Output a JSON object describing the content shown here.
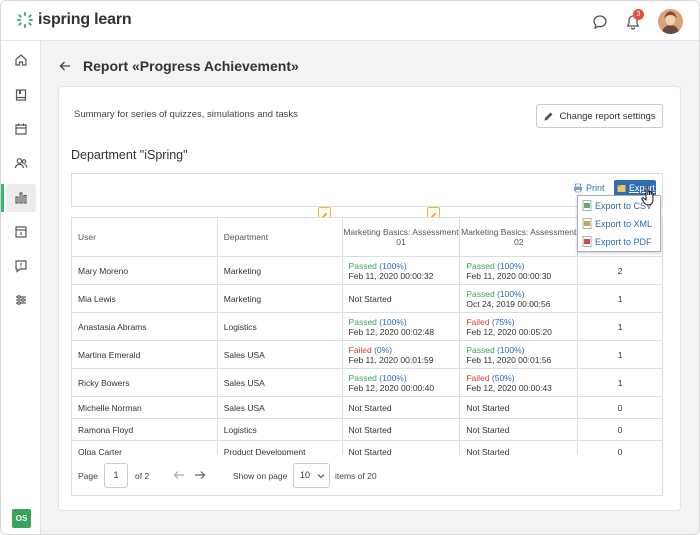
{
  "app": {
    "logo_text": "ispring learn",
    "notification_count": "3",
    "user_initials": "OS"
  },
  "colors": {
    "accent": "#3cb371",
    "link": "#2a6bb5",
    "passed": "#3fa34d",
    "failed": "#d0462e",
    "export_button": "#2f6db5"
  },
  "sidebar": {
    "items": [
      {
        "icon": "home-icon"
      },
      {
        "icon": "book-icon"
      },
      {
        "icon": "calendar-icon"
      },
      {
        "icon": "users-icon"
      },
      {
        "icon": "reports-icon",
        "active": true
      },
      {
        "icon": "tasks-icon"
      },
      {
        "icon": "messages-icon"
      },
      {
        "icon": "settings-icon"
      }
    ]
  },
  "header": {
    "title": "Report «Progress Achievement»"
  },
  "card": {
    "summary": "Summary for series of quizzes, simulations and tasks",
    "settings_button": "Change report settings",
    "department_title": "Department \"iSpring\""
  },
  "toolbar": {
    "print_label": "Print",
    "export_label": "Export",
    "export_menu": [
      "Export to CSV",
      "Export to XML",
      "Export to PDF"
    ]
  },
  "table": {
    "columns": [
      "User",
      "Department",
      "Marketing Basics: Assessment 01",
      "Marketing Basics: Assessment 02",
      ""
    ],
    "rows": [
      {
        "user": "Mary Moreno",
        "department": "Marketing",
        "a1": {
          "status": "Passed",
          "pct": "(100%)",
          "date": "Feb 11, 2020 00:00:32"
        },
        "a2": {
          "status": "Passed",
          "pct": "(100%)",
          "date": "Feb 11, 2020 00:00:30"
        },
        "count": "2"
      },
      {
        "user": "Mia Lewis",
        "department": "Marketing",
        "a1": {
          "status": "Not Started",
          "pct": "",
          "date": ""
        },
        "a2": {
          "status": "Passed",
          "pct": "(100%)",
          "date": "Oct 24, 2019 00:00:56"
        },
        "count": "1"
      },
      {
        "user": "Anastasia Abrams",
        "department": "Logistics",
        "a1": {
          "status": "Passed",
          "pct": "(100%)",
          "date": "Feb 12, 2020 00:02:48"
        },
        "a2": {
          "status": "Failed",
          "pct": "(75%)",
          "date": "Feb 12, 2020 00:05:20"
        },
        "count": "1"
      },
      {
        "user": "Martina Emerald",
        "department": "Sales USA",
        "a1": {
          "status": "Failed",
          "pct": "(0%)",
          "date": "Feb 11, 2020 00:01:59"
        },
        "a2": {
          "status": "Passed",
          "pct": "(100%)",
          "date": "Feb 11, 2020 00:01:56"
        },
        "count": "1"
      },
      {
        "user": "Ricky Bowers",
        "department": "Sales USA",
        "a1": {
          "status": "Passed",
          "pct": "(100%)",
          "date": "Feb 12, 2020 00:00:40"
        },
        "a2": {
          "status": "Failed",
          "pct": "(50%)",
          "date": "Feb 12, 2020 00:00:43"
        },
        "count": "1"
      },
      {
        "user": "Michelle Norman",
        "department": "Sales USA",
        "a1": {
          "status": "Not Started",
          "pct": "",
          "date": ""
        },
        "a2": {
          "status": "Not Started",
          "pct": "",
          "date": ""
        },
        "count": "0"
      },
      {
        "user": "Ramona Floyd",
        "department": "Logistics",
        "a1": {
          "status": "Not Started",
          "pct": "",
          "date": ""
        },
        "a2": {
          "status": "Not Started",
          "pct": "",
          "date": ""
        },
        "count": "0"
      },
      {
        "user": "Olga Carter",
        "department": "Product Development",
        "a1": {
          "status": "Not Started",
          "pct": "",
          "date": ""
        },
        "a2": {
          "status": "Not Started",
          "pct": "",
          "date": ""
        },
        "count": "0"
      }
    ]
  },
  "pager": {
    "page_label": "Page",
    "page_value": "1",
    "of_label": "of 2",
    "show_label": "Show on page",
    "per_page": "10",
    "items_label": "items of 20"
  }
}
